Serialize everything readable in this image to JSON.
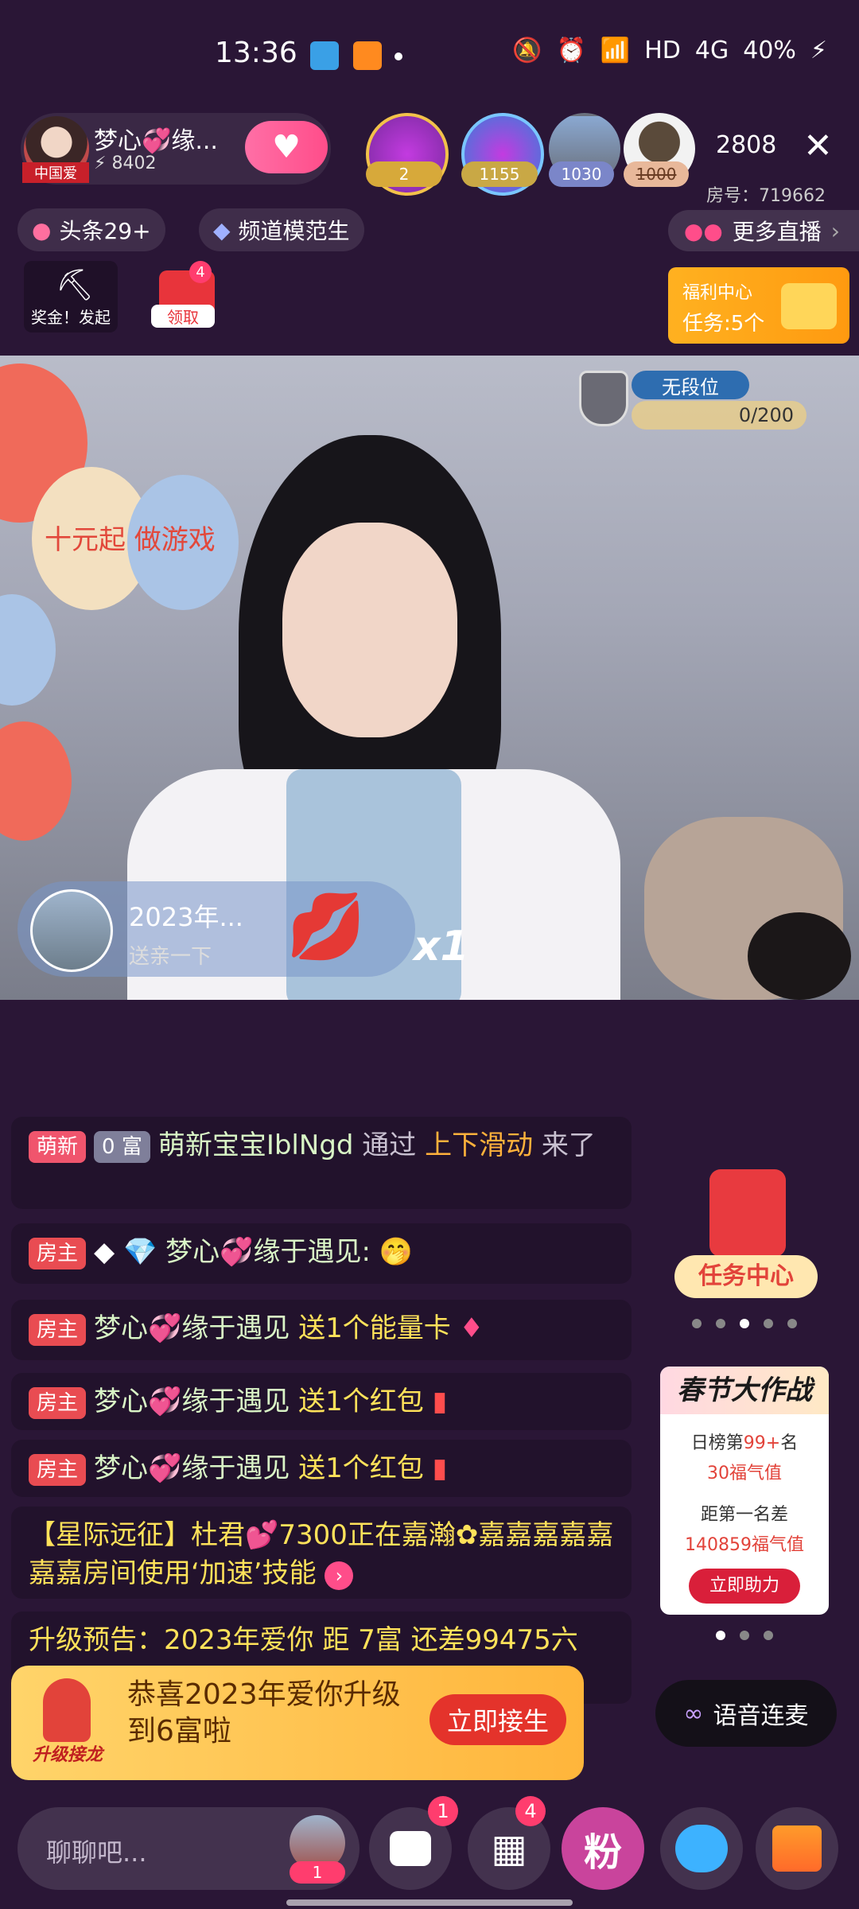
{
  "status_bar": {
    "time": "13:36",
    "network": "HD",
    "signal": "4G",
    "battery": "40%"
  },
  "header": {
    "host_name": "梦心💞缘...",
    "host_points": "8402",
    "host_badge": "中国爱",
    "rank_badges": [
      "2",
      "1155",
      "1030",
      "1000"
    ],
    "viewer_count": "2808",
    "room_number": "房号：719662"
  },
  "chips": {
    "headline": "头条29+",
    "channel": "频道模范生",
    "more_live": "更多直播"
  },
  "cards": {
    "bonus": "奖金！发起",
    "red_packet": "领取",
    "red_packet_count": "4"
  },
  "welfare": {
    "title": "福利中心",
    "tasks": "任务:5个"
  },
  "video": {
    "balloon_text": "十元起 做游戏",
    "rank_label": "无段位",
    "rank_progress": "0/200",
    "gift_name": "2023年...",
    "gift_action": "送亲一下",
    "gift_multiplier": "x1"
  },
  "chat": [
    {
      "tags": [
        "萌新",
        "0 富"
      ],
      "user": "萌新宝宝IblNgd",
      "text_a": "通过",
      "text_b": "上下滑动",
      "text_c": "来了"
    },
    {
      "tag": "房主",
      "user": "梦心💞缘于遇见:",
      "emoji": "🤭"
    },
    {
      "tag": "房主",
      "user": "梦心💞缘于遇见",
      "action": "送1个能量卡"
    },
    {
      "tag": "房主",
      "user": "梦心💞缘于遇见",
      "action": "送1个红包"
    },
    {
      "tag": "房主",
      "user": "梦心💞缘于遇见",
      "action": "送1个红包"
    },
    {
      "text": "【星际远征】杜君💕7300正在嘉瀚✿嘉嘉嘉嘉嘉嘉嘉房间使用‘加速’技能"
    },
    {
      "text": "升级预告：2023年爱你 距 7富 还差99475六"
    }
  ],
  "task_center": {
    "label": "任务中心"
  },
  "spring_card": {
    "title": "春节大作战",
    "daily_rank": "日榜第",
    "rank_value": "99+",
    "rank_suffix": "名",
    "points": "30福气值",
    "gap_label": "距第一名差",
    "gap_value": "140859福气值",
    "button": "立即助力"
  },
  "voice_button": "语音连麦",
  "upgrade_banner": {
    "badge": "升级接龙",
    "line1": "恭喜2023年爱你升级",
    "line2": "到6富啦",
    "button": "立即接生"
  },
  "bottom_bar": {
    "chat_placeholder": "聊聊吧...",
    "avatar_count": "1",
    "message_badge": "1",
    "apps_badge": "4",
    "fan_label": "粉"
  }
}
